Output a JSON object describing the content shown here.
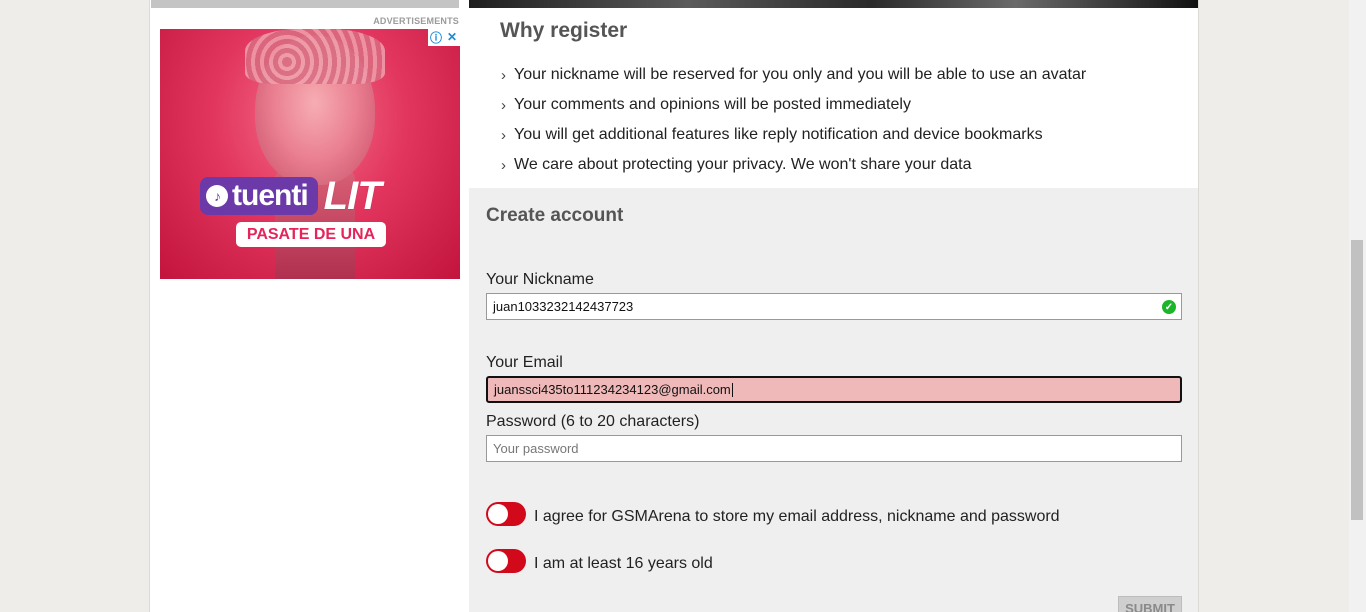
{
  "sidebar": {
    "ad_label": "ADVERTISEMENTS",
    "ad": {
      "brand": "tuenti",
      "tagline": "LIT",
      "cta": "PASATE DE UNA",
      "info_icon": "info-icon",
      "close_icon": "close-icon"
    }
  },
  "why_register": {
    "title": "Why register",
    "items": [
      "Your nickname will be reserved for you only and you will be able to use an avatar",
      "Your comments and opinions will be posted immediately",
      "You will get additional features like reply notification and device bookmarks",
      "We care about protecting your privacy. We won't share your data"
    ]
  },
  "create_account": {
    "title": "Create account",
    "nickname": {
      "label": "Your Nickname",
      "value": "juan1033232142437723",
      "status_icon": "check-circle-icon"
    },
    "email": {
      "label": "Your Email",
      "value": "juanssci435to111234234123@gmail.com"
    },
    "password": {
      "label": "Password (6 to 20 characters)",
      "placeholder": "Your password",
      "value": ""
    },
    "agree_toggle": {
      "label": "I agree for GSMArena to store my email address, nickname and password",
      "on": false
    },
    "age_toggle": {
      "label": "I am at least 16 years old",
      "on": false
    },
    "submit_label": "SUBMIT"
  },
  "colors": {
    "toggle_off": "#d2091a",
    "invalid_field": "#f0b9b9",
    "valid_check": "#1cb52a"
  }
}
